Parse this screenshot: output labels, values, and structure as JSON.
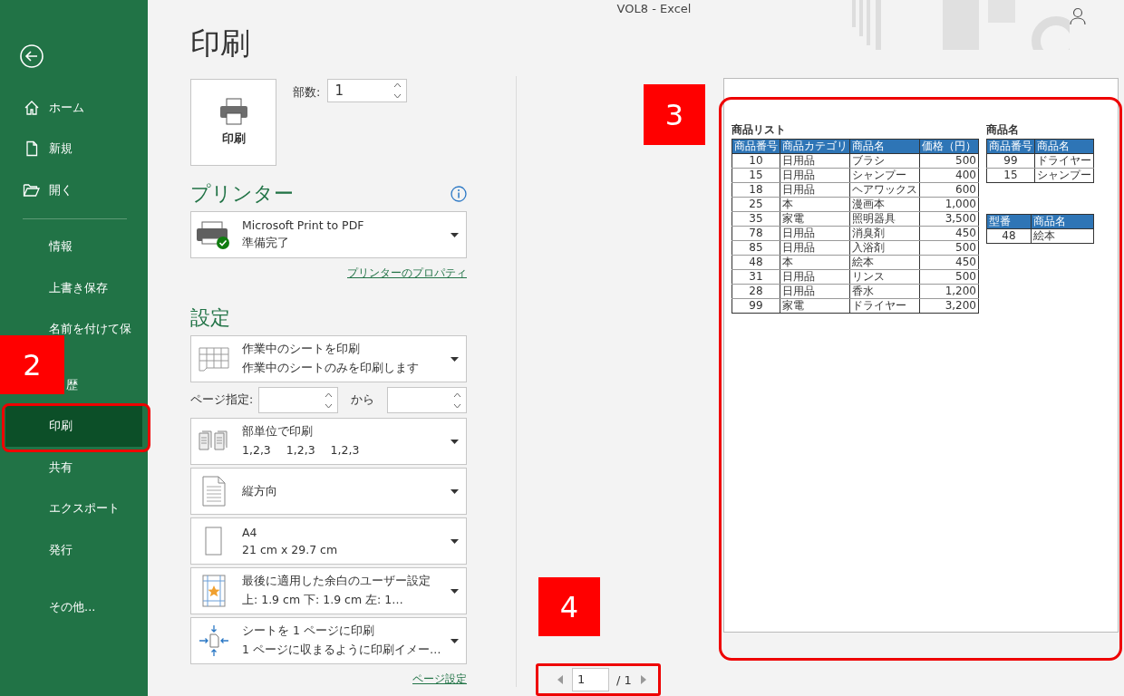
{
  "window": {
    "title": "VOL8  -  Excel"
  },
  "sidebar": {
    "items": [
      {
        "label": "ホーム",
        "selected": false
      },
      {
        "label": "新規",
        "selected": false
      },
      {
        "label": "開く",
        "selected": false
      },
      {
        "label": "情報",
        "selected": false
      },
      {
        "label": "上書き保存",
        "selected": false
      },
      {
        "label": "名前を付けて保",
        "selected": false
      },
      {
        "label": "歴",
        "selected": false,
        "kind": "partly_covered"
      },
      {
        "label": "印刷",
        "selected": true
      },
      {
        "label": "共有",
        "selected": false
      },
      {
        "label": "エクスポート",
        "selected": false
      },
      {
        "label": "発行",
        "selected": false
      },
      {
        "label": "その他...",
        "selected": false
      }
    ]
  },
  "print_panel": {
    "heading": "印刷",
    "print_button": "印刷",
    "copies_label": "部数:",
    "copies_value": "1",
    "printer_heading": "プリンター",
    "printer_name": "Microsoft Print to PDF",
    "printer_status": "準備完了",
    "printer_properties": "プリンターのプロパティ",
    "settings_heading": "設定",
    "page_range": {
      "label": "ページ指定:",
      "to": "から"
    },
    "settings": [
      {
        "kind": "sheet",
        "line1": "作業中のシートを印刷",
        "line2": "作業中のシートのみを印刷します"
      },
      {
        "kind": "range"
      },
      {
        "kind": "collate",
        "line1": "部単位で印刷",
        "line2": "1,2,3　 1,2,3　 1,2,3"
      },
      {
        "kind": "orientation",
        "line1": "縦方向"
      },
      {
        "kind": "paper",
        "line1": "A4",
        "line2": "21 cm x 29.7 cm"
      },
      {
        "kind": "margins",
        "line1": "最後に適用した余白のユーザー設定",
        "line2": "上: 1.9 cm 下: 1.9 cm 左: 1…"
      },
      {
        "kind": "scaling",
        "line1": "シートを 1 ページに印刷",
        "line2": "1 ページに収まるように印刷イメー…"
      }
    ],
    "page_setup": "ページ設定"
  },
  "preview": {
    "page_number": "1",
    "page_total": "/ 1",
    "tables": [
      {
        "title": "商品リスト",
        "columns": [
          "商品番号",
          "商品カテゴリ",
          "商品名",
          "価格（円）"
        ],
        "rows": [
          [
            "10",
            "日用品",
            "ブラシ",
            "500"
          ],
          [
            "15",
            "日用品",
            "シャンプー",
            "400"
          ],
          [
            "18",
            "日用品",
            "ヘアワックス",
            "600"
          ],
          [
            "25",
            "本",
            "漫画本",
            "1,000"
          ],
          [
            "35",
            "家電",
            "照明器具",
            "3,500"
          ],
          [
            "78",
            "日用品",
            "消臭剤",
            "450"
          ],
          [
            "85",
            "日用品",
            "入浴剤",
            "500"
          ],
          [
            "48",
            "本",
            "絵本",
            "450"
          ],
          [
            "31",
            "日用品",
            "リンス",
            "500"
          ],
          [
            "28",
            "日用品",
            "香水",
            "1,200"
          ],
          [
            "99",
            "家電",
            "ドライヤー",
            "3,200"
          ]
        ]
      },
      {
        "title": "商品名",
        "columns": [
          "商品番号",
          "商品名"
        ],
        "rows": [
          [
            "99",
            "ドライヤー"
          ],
          [
            "15",
            "シャンプー"
          ]
        ]
      },
      {
        "columns": [
          "型番",
          "商品名"
        ],
        "rows": [
          [
            "48",
            "絵本"
          ]
        ]
      }
    ]
  },
  "annotations": [
    "2",
    "3",
    "4"
  ]
}
